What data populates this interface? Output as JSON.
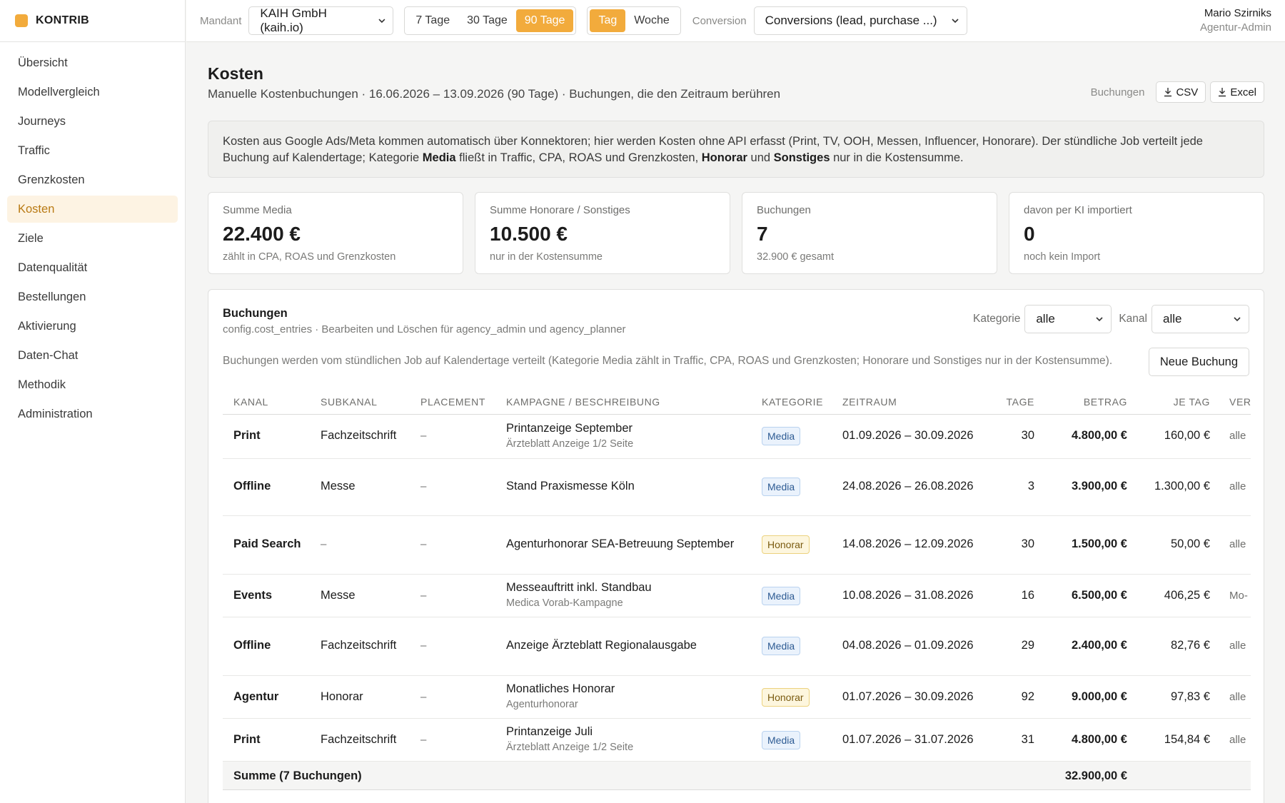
{
  "app": {
    "name": "KONTRIB",
    "accent": "#f2ab3c"
  },
  "sidebar": {
    "items": [
      {
        "label": "Übersicht",
        "active": false
      },
      {
        "label": "Modellvergleich",
        "active": false
      },
      {
        "label": "Journeys",
        "active": false
      },
      {
        "label": "Traffic",
        "active": false
      },
      {
        "label": "Grenzkosten",
        "active": false
      },
      {
        "label": "Kosten",
        "active": true
      },
      {
        "label": "Ziele",
        "active": false
      },
      {
        "label": "Datenqualität",
        "active": false
      },
      {
        "label": "Bestellungen",
        "active": false
      },
      {
        "label": "Aktivierung",
        "active": false
      },
      {
        "label": "Daten-Chat",
        "active": false
      },
      {
        "label": "Methodik",
        "active": false
      },
      {
        "label": "Administration",
        "active": false
      }
    ]
  },
  "topbar": {
    "mandant_label": "Mandant",
    "mandant_value": "KAIH GmbH (kaih.io)",
    "ranges": [
      {
        "label": "7 Tage",
        "active": false
      },
      {
        "label": "30 Tage",
        "active": false
      },
      {
        "label": "90 Tage",
        "active": true
      }
    ],
    "granularity": [
      {
        "label": "Tag",
        "active": true
      },
      {
        "label": "Woche",
        "active": false
      }
    ],
    "conversion_label": "Conversion",
    "conversion_value": "Conversions (lead, purchase ...)",
    "user_name": "Mario Szirniks",
    "user_role": "Agentur-Admin"
  },
  "page": {
    "title": "Kosten",
    "subtitle": "Manuelle Kostenbuchungen · 16.06.2026 – 13.09.2026 (90 Tage) · Buchungen, die den Zeitraum berühren",
    "export_label": "Buchungen",
    "export_csv": "CSV",
    "export_excel": "Excel"
  },
  "info": {
    "p1": "Kosten aus Google Ads/Meta kommen automatisch über Konnektoren; hier werden Kosten ohne API erfasst (Print, TV, OOH, Messen, Influencer, Honorare). Der stündliche Job verteilt jede Buchung auf Kalendertage; Kategorie ",
    "b1": "Media",
    "p2": " fließt in Traffic, CPA, ROAS und Grenzkosten, ",
    "b2": "Honorar",
    "p3": " und ",
    "b3": "Sonstiges",
    "p4": " nur in die Kostensumme."
  },
  "kpis": [
    {
      "label": "Summe Media",
      "value": "22.400 €",
      "note": "zählt in CPA, ROAS und Grenzkosten"
    },
    {
      "label": "Summe Honorare / Sonstiges",
      "value": "10.500 €",
      "note": "nur in der Kostensumme"
    },
    {
      "label": "Buchungen",
      "value": "7",
      "note": "32.900 € gesamt"
    },
    {
      "label": "davon per KI importiert",
      "value": "0",
      "note": "noch kein Import"
    }
  ],
  "bookings": {
    "title": "Buchungen",
    "subtitle": "config.cost_entries · Bearbeiten und Löschen für agency_admin und agency_planner",
    "kategorie_label": "Kategorie",
    "kategorie_value": "alle",
    "kanal_label": "Kanal",
    "kanal_value": "alle",
    "hint": "Buchungen werden vom stündlichen Job auf Kalendertage verteilt (Kategorie Media zählt in Traffic, CPA, ROAS und Grenzkosten; Honorare und Sonstiges nur in der Kostensumme).",
    "new_button": "Neue Buchung",
    "columns": [
      "KANAL",
      "SUBKANAL",
      "PLACEMENT",
      "KAMPAGNE / BESCHREIBUNG",
      "KATEGORIE",
      "ZEITRAUM",
      "TAGE",
      "BETRAG",
      "JE TAG",
      "VER"
    ],
    "rows": [
      {
        "kanal": "Print",
        "subkanal": "Fachzeitschrift",
        "placement": "–",
        "kampagne": "Printanzeige September",
        "beschreibung": "Ärzteblatt Anzeige 1/2 Seite",
        "kategorie": "Media",
        "zeitraum": "01.09.2026 – 30.09.2026",
        "tage": "30",
        "betrag": "4.800,00 €",
        "je_tag": "160,00 €",
        "ver": "alle"
      },
      {
        "kanal": "Offline",
        "subkanal": "Messe",
        "placement": "–",
        "kampagne": "Stand Praxismesse Köln",
        "beschreibung": "",
        "kategorie": "Media",
        "zeitraum": "24.08.2026 – 26.08.2026",
        "tage": "3",
        "betrag": "3.900,00 €",
        "je_tag": "1.300,00 €",
        "ver": "alle"
      },
      {
        "kanal": "Paid Search",
        "subkanal": "–",
        "placement": "–",
        "kampagne": "Agenturhonorar SEA-Betreuung September",
        "beschreibung": "",
        "kategorie": "Honorar",
        "zeitraum": "14.08.2026 – 12.09.2026",
        "tage": "30",
        "betrag": "1.500,00 €",
        "je_tag": "50,00 €",
        "ver": "alle"
      },
      {
        "kanal": "Events",
        "subkanal": "Messe",
        "placement": "–",
        "kampagne": "Messeauftritt inkl. Standbau",
        "beschreibung": "Medica Vorab-Kampagne",
        "kategorie": "Media",
        "zeitraum": "10.08.2026 – 31.08.2026",
        "tage": "16",
        "betrag": "6.500,00 €",
        "je_tag": "406,25 €",
        "ver": "Mo-"
      },
      {
        "kanal": "Offline",
        "subkanal": "Fachzeitschrift",
        "placement": "–",
        "kampagne": "Anzeige Ärzteblatt Regionalausgabe",
        "beschreibung": "",
        "kategorie": "Media",
        "zeitraum": "04.08.2026 – 01.09.2026",
        "tage": "29",
        "betrag": "2.400,00 €",
        "je_tag": "82,76 €",
        "ver": "alle"
      },
      {
        "kanal": "Agentur",
        "subkanal": "Honorar",
        "placement": "–",
        "kampagne": "Monatliches Honorar",
        "beschreibung": "Agenturhonorar",
        "kategorie": "Honorar",
        "zeitraum": "01.07.2026 – 30.09.2026",
        "tage": "92",
        "betrag": "9.000,00 €",
        "je_tag": "97,83 €",
        "ver": "alle"
      },
      {
        "kanal": "Print",
        "subkanal": "Fachzeitschrift",
        "placement": "–",
        "kampagne": "Printanzeige Juli",
        "beschreibung": "Ärzteblatt Anzeige 1/2 Seite",
        "kategorie": "Media",
        "zeitraum": "01.07.2026 – 31.07.2026",
        "tage": "31",
        "betrag": "4.800,00 €",
        "je_tag": "154,84 €",
        "ver": "alle"
      }
    ],
    "total_label": "Summe (7 Buchungen)",
    "total_value": "32.900,00 €"
  }
}
